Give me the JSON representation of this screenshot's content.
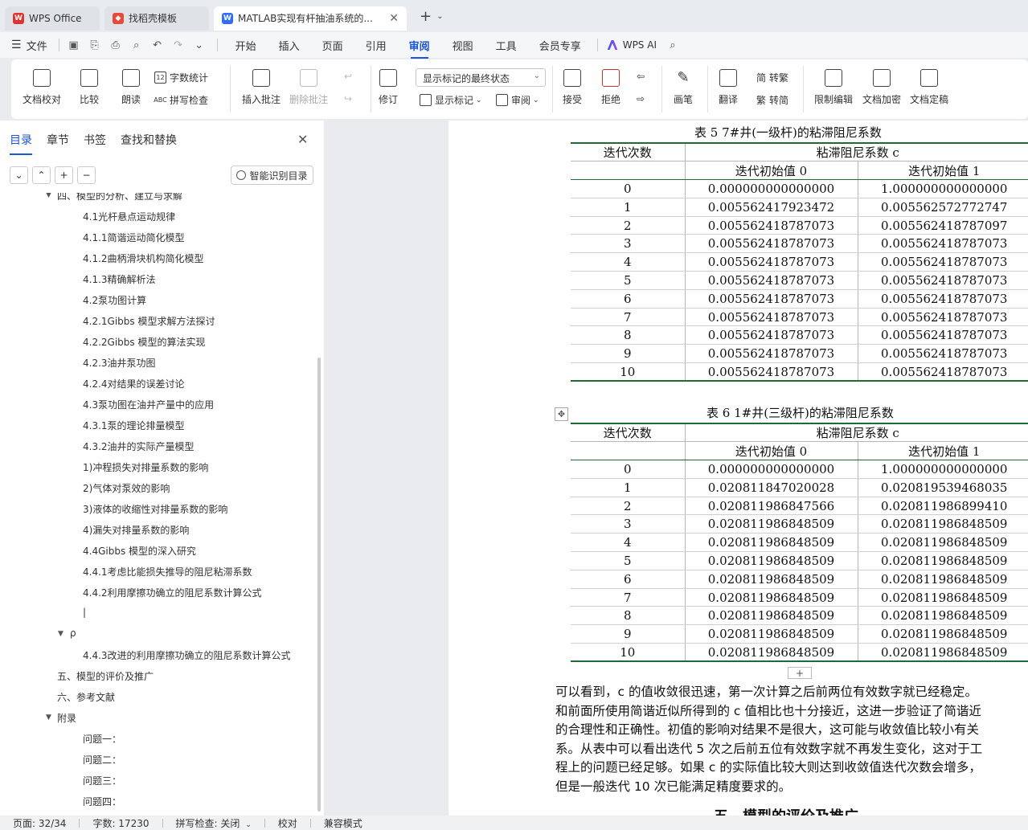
{
  "titlebar": {
    "tabs": [
      {
        "label": "WPS Office"
      },
      {
        "label": "找稻壳模板"
      },
      {
        "label": "MATLAB实现有杆抽油系统的..."
      }
    ]
  },
  "menubar": {
    "file_label": "文件",
    "tabs": [
      "开始",
      "插入",
      "页面",
      "引用",
      "审阅",
      "视图",
      "工具",
      "会员专享"
    ],
    "active_tab": "审阅",
    "ai_label": "WPS AI"
  },
  "ribbon": {
    "doc_check": "文档校对",
    "compare": "比较",
    "read_aloud": "朗读",
    "word_count": "字数统计",
    "spell_check": "拼写检查",
    "insert_comment": "插入批注",
    "delete_comment": "删除批注",
    "revise": "修订",
    "markup_select": "显示标记的最终状态",
    "show_markup": "显示标记",
    "review": "审阅",
    "accept": "接受",
    "reject": "拒绝",
    "pen": "画笔",
    "translate": "翻译",
    "to_traditional": "转繁",
    "to_simplified": "转简",
    "restrict_edit": "限制编辑",
    "doc_encrypt": "文档加密",
    "doc_finalize": "文档定稿"
  },
  "panel": {
    "tabs": [
      "目录",
      "章节",
      "书签",
      "查找和替换"
    ],
    "smart_toc": "智能识别目录",
    "toc": [
      {
        "text": "四、模型的分析、建立与求解",
        "level": 1,
        "arrow": true
      },
      {
        "text": "4.1光杆悬点运动规律",
        "level": 2
      },
      {
        "text": "4.1.1简谐运动简化模型",
        "level": 2
      },
      {
        "text": "4.1.2曲柄滑块机构简化模型",
        "level": 2
      },
      {
        "text": "4.1.3精确解析法",
        "level": 2
      },
      {
        "text": "4.2泵功图计算",
        "level": 2
      },
      {
        "text": "4.2.1Gibbs 模型求解方法探讨",
        "level": 2
      },
      {
        "text": "4.2.2Gibbs 模型的算法实现",
        "level": 2
      },
      {
        "text": "4.2.3油井泵功图",
        "level": 2
      },
      {
        "text": "4.2.4对结果的误差讨论",
        "level": 2
      },
      {
        "text": "4.3泵功图在油井产量中的应用",
        "level": 2
      },
      {
        "text": "4.3.1泵的理论排量模型",
        "level": 2
      },
      {
        "text": "4.3.2油井的实际产量模型",
        "level": 2
      },
      {
        "text": "1)冲程损失对排量系数的影响",
        "level": 2
      },
      {
        "text": "2)气体对泵效的影响",
        "level": 2
      },
      {
        "text": "3)液体的收缩性对排量系数的影响",
        "level": 2
      },
      {
        "text": "4)漏失对排量系数的影响",
        "level": 2
      },
      {
        "text": "4.4Gibbs 模型的深入研究",
        "level": 2
      },
      {
        "text": "4.4.1考虑比能损失推导的阻尼粘滞系数",
        "level": 2
      },
      {
        "text": "4.4.2利用摩擦功确立的阻尼系数计算公式",
        "level": 2
      },
      {
        "text": "|",
        "level": 2
      },
      {
        "text": "ρ",
        "level": 1.5,
        "arrow": true
      },
      {
        "text": "4.4.3改进的利用摩擦功确立的阻尼系数计算公式",
        "level": 2
      },
      {
        "text": "五、模型的评价及推广",
        "level": 1
      },
      {
        "text": "六、参考文献",
        "level": 1
      },
      {
        "text": "附录",
        "level": 1,
        "arrow": true
      },
      {
        "text": "问题一：",
        "level": 2
      },
      {
        "text": "问题二：",
        "level": 2
      },
      {
        "text": "问题三：",
        "level": 2
      },
      {
        "text": "问题四：",
        "level": 2
      }
    ]
  },
  "document": {
    "table5": {
      "caption": "表 5    7#井(一级杆)的粘滞阻尼系数",
      "col_iter": "迭代次数",
      "col_c": "粘滞阻尼系数 c",
      "sub0": "迭代初始值  0",
      "sub1": "迭代初始值  1",
      "rows": [
        [
          "0",
          "0.000000000000000",
          "1.000000000000000"
        ],
        [
          "1",
          "0.005562417923472",
          "0.005562572772747"
        ],
        [
          "2",
          "0.005562418787073",
          "0.005562418787097"
        ],
        [
          "3",
          "0.005562418787073",
          "0.005562418787073"
        ],
        [
          "4",
          "0.005562418787073",
          "0.005562418787073"
        ],
        [
          "5",
          "0.005562418787073",
          "0.005562418787073"
        ],
        [
          "6",
          "0.005562418787073",
          "0.005562418787073"
        ],
        [
          "7",
          "0.005562418787073",
          "0.005562418787073"
        ],
        [
          "8",
          "0.005562418787073",
          "0.005562418787073"
        ],
        [
          "9",
          "0.005562418787073",
          "0.005562418787073"
        ],
        [
          "10",
          "0.005562418787073",
          "0.005562418787073"
        ]
      ]
    },
    "table6": {
      "caption": "表 6    1#井(三级杆)的粘滞阻尼系数",
      "col_iter": "迭代次数",
      "col_c": "粘滞阻尼系数 c",
      "sub0": "迭代初始值  0",
      "sub1": "迭代初始值  1",
      "rows": [
        [
          "0",
          "0.000000000000000",
          "1.000000000000000"
        ],
        [
          "1",
          "0.020811847020028",
          "0.020819539468035"
        ],
        [
          "2",
          "0.020811986847566",
          "0.020811986899410"
        ],
        [
          "3",
          "0.020811986848509",
          "0.020811986848509"
        ],
        [
          "4",
          "0.020811986848509",
          "0.020811986848509"
        ],
        [
          "5",
          "0.020811986848509",
          "0.020811986848509"
        ],
        [
          "6",
          "0.020811986848509",
          "0.020811986848509"
        ],
        [
          "7",
          "0.020811986848509",
          "0.020811986848509"
        ],
        [
          "8",
          "0.020811986848509",
          "0.020811986848509"
        ],
        [
          "9",
          "0.020811986848509",
          "0.020811986848509"
        ],
        [
          "10",
          "0.020811986848509",
          "0.020811986848509"
        ]
      ]
    },
    "paragraph": [
      "    可以看到，c 的值收敛很迅速，第一次计算之后前两位有效数字就已经稳定。",
      "和前面所使用简谐近似所得到的 c 值相比也十分接近，这进一步验证了简谐近",
      "的合理性和正确性。初值的影响对结果不是很大，这可能与收敛值比较小有关",
      "系。从表中可以看出迭代 5 次之后前五位有效数字就不再发生变化，这对于工",
      "程上的问题已经足够。如果 c 的实际值比较大则达到收敛值迭代次数会增多，",
      "但是一般迭代 10 次已能满足精度要求的。"
    ],
    "next_heading": "五、模型的评价及推广"
  },
  "statusbar": {
    "page": "页面: 32/34",
    "words": "字数: 17230",
    "spell": "拼写检查: 关闭",
    "proof": "校对",
    "compat": "兼容模式"
  }
}
